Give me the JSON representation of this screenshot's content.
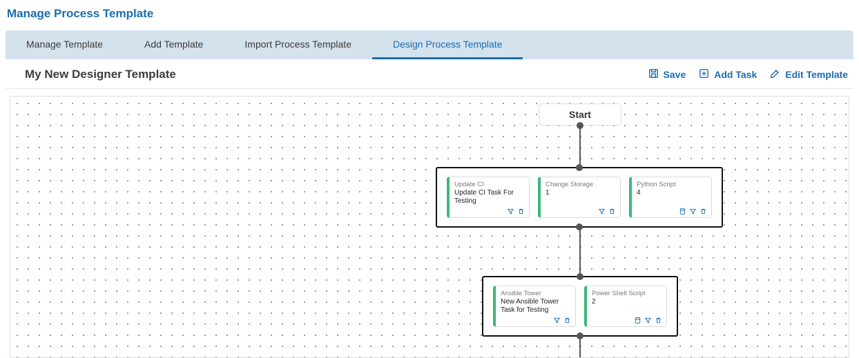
{
  "page_title": "Manage Process Template",
  "tabs": [
    {
      "label": "Manage Template",
      "active": false
    },
    {
      "label": "Add Template",
      "active": false
    },
    {
      "label": "Import Process Template",
      "active": false
    },
    {
      "label": "Design Process Template",
      "active": true
    }
  ],
  "template_name": "My New Designer Template",
  "actions": {
    "save": "Save",
    "add_task": "Add Task",
    "edit_template": "Edit Template"
  },
  "diagram": {
    "start_label": "Start",
    "stages": [
      {
        "tasks": [
          {
            "category": "Update CI",
            "name": "Update CI Task For Testing",
            "icons": [
              "filter",
              "trash"
            ]
          },
          {
            "category": "Change Storage",
            "name": "1",
            "icons": [
              "filter",
              "trash"
            ]
          },
          {
            "category": "Python Script",
            "name": "4",
            "icons": [
              "db",
              "filter",
              "trash"
            ]
          }
        ]
      },
      {
        "tasks": [
          {
            "category": "Ansible Tower",
            "name": "New Ansible Tower Task for Testing",
            "icons": [
              "filter",
              "trash"
            ]
          },
          {
            "category": "Power Shell Script",
            "name": "2",
            "icons": [
              "db",
              "filter",
              "trash"
            ]
          }
        ]
      }
    ]
  }
}
